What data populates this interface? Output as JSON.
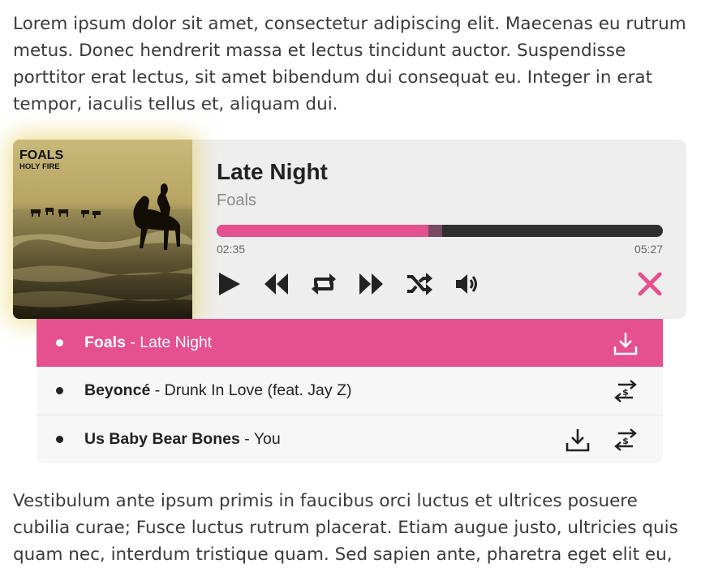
{
  "paragraphs": {
    "top": "Lorem ipsum dolor sit amet, consectetur adipiscing elit. Maecenas eu rutrum metus. Donec hendrerit massa et lectus tincidunt auctor. Suspendisse porttitor erat lectus, sit amet bibendum dui consequat eu. Integer in erat tempor, iaculis tellus et, aliquam dui.",
    "bottom": "Vestibulum ante ipsum primis in faucibus orci luctus et ultrices posuere cubilia curae; Fusce luctus rutrum placerat. Etiam augue justo, ultricies quis quam nec, interdum tristique quam. Sed sapien ante, pharetra eget elit eu,"
  },
  "player": {
    "cover": {
      "line1": "FOALS",
      "line2": "HOLY FIRE"
    },
    "title": "Late Night",
    "artist": "Foals",
    "progress_fraction": 0.475,
    "buffered_fraction": 0.505,
    "time_current": "02:35",
    "time_total": "05:27",
    "controls": [
      "play-icon",
      "rewind-icon",
      "repeat-icon",
      "fast-forward-icon",
      "shuffle-icon",
      "volume-icon",
      "close-icon"
    ]
  },
  "playlist": {
    "items": [
      {
        "artist": "Foals",
        "separator": " - ",
        "song": "Late Night",
        "active": true,
        "icons": [
          "download-icon"
        ]
      },
      {
        "artist": "Beyoncé",
        "separator": " - ",
        "song": "Drunk In Love (feat. Jay Z)",
        "active": false,
        "icons": [
          "buy-icon"
        ]
      },
      {
        "artist": "Us Baby Bear Bones",
        "separator": " - ",
        "song": "You",
        "active": false,
        "icons": [
          "download-icon",
          "buy-icon"
        ]
      }
    ]
  },
  "colors": {
    "accent": "#e5508f",
    "buffer": "#7a4a62",
    "track": "#2f2f2f",
    "panel": "#eeeeee",
    "icon": "#222222"
  }
}
